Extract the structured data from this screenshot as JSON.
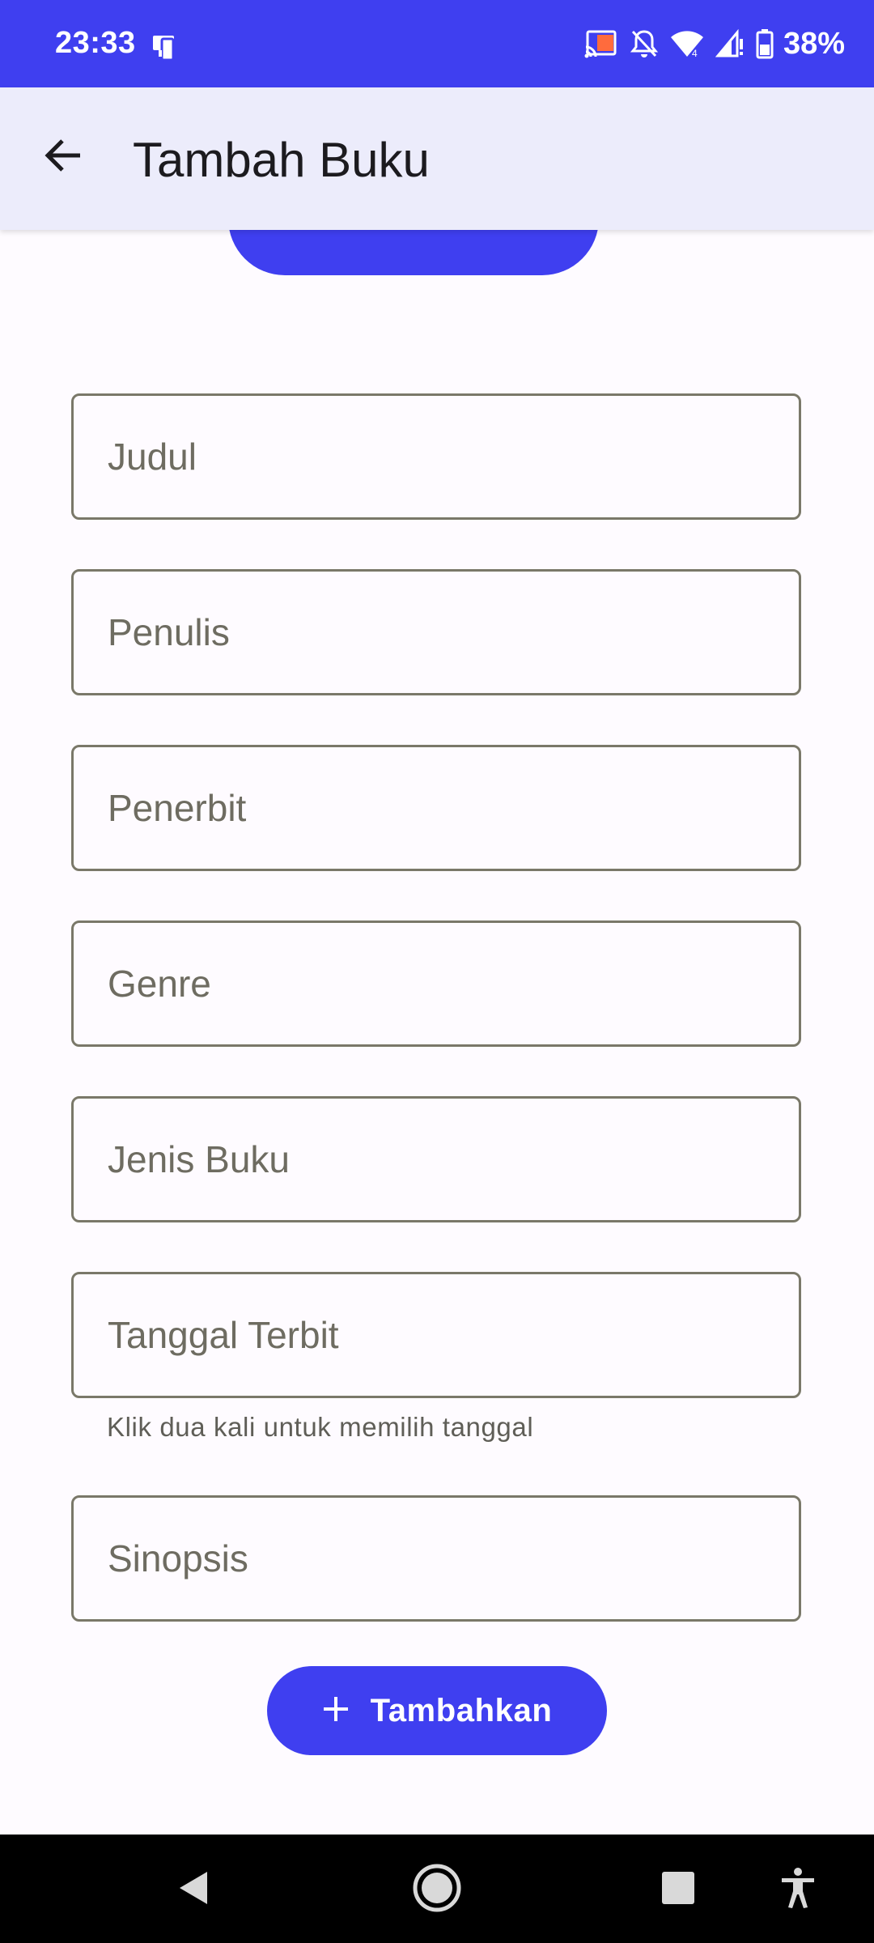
{
  "status_bar": {
    "time": "23:33",
    "battery": "38%",
    "icons": [
      "phone-link-icon",
      "cast-icon",
      "notifications-off-icon",
      "wifi-icon",
      "signal-icon",
      "battery-icon"
    ]
  },
  "app_bar": {
    "title": "Tambah Buku",
    "back_icon": "arrow-back-icon"
  },
  "form": {
    "fields": [
      {
        "placeholder": "Judul"
      },
      {
        "placeholder": "Penulis"
      },
      {
        "placeholder": "Penerbit"
      },
      {
        "placeholder": "Genre"
      },
      {
        "placeholder": "Jenis Buku"
      },
      {
        "placeholder": "Tanggal Terbit",
        "helper": "Klik dua kali untuk memilih tanggal"
      },
      {
        "placeholder": "Sinopsis"
      }
    ],
    "submit_label": "Tambahkan",
    "submit_icon": "plus-icon"
  },
  "nav_bar": {
    "icons": [
      "back-triangle-icon",
      "home-circle-icon",
      "recents-square-icon",
      "accessibility-icon"
    ]
  },
  "colors": {
    "primary": "#3f3ff0",
    "app_bar_bg": "#ececfb",
    "background": "#fefbff",
    "outline": "#7a7869"
  }
}
